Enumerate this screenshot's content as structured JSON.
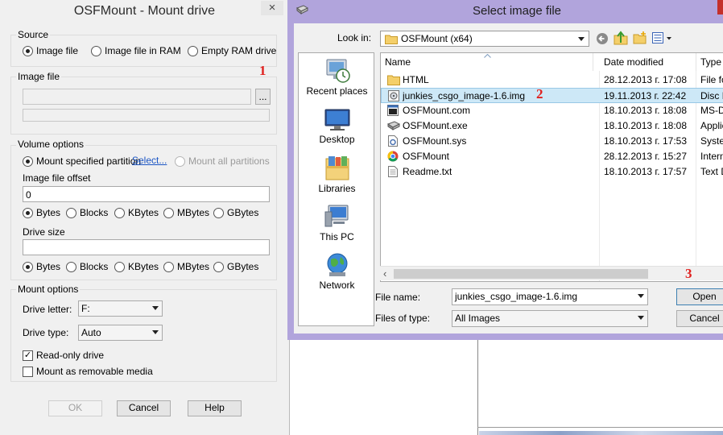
{
  "osfmount": {
    "title": "OSFMount - Mount drive",
    "close_glyph": "×",
    "source": {
      "group_label": "Source",
      "options": [
        "Image file",
        "Image file in RAM",
        "Empty RAM drive"
      ],
      "selected": "Image file"
    },
    "image_file": {
      "group_label": "Image file",
      "path_value": "",
      "browse_label": "..."
    },
    "volume_options": {
      "group_label": "Volume options",
      "mount_specified_partition": "Mount specified partition",
      "select_link": "Select...",
      "mount_all_partitions": "Mount all partitions",
      "offset_label": "Image file offset",
      "offset_value": "0",
      "units": [
        "Bytes",
        "Blocks",
        "KBytes",
        "MBytes",
        "GBytes"
      ],
      "drive_size_label": "Drive size",
      "drive_size_value": ""
    },
    "mount_options": {
      "group_label": "Mount options",
      "drive_letter_label": "Drive letter:",
      "drive_letter_value": "F:",
      "drive_type_label": "Drive type:",
      "drive_type_value": "Auto",
      "read_only_label": "Read-only drive",
      "read_only_checked": true,
      "removable_label": "Mount as removable media",
      "removable_checked": false
    },
    "buttons": {
      "ok": "OK",
      "cancel": "Cancel",
      "help": "Help"
    }
  },
  "select_dialog": {
    "title": "Select image file",
    "look_in_label": "Look in:",
    "look_in_value": "OSFMount (x64)",
    "places": [
      "Recent places",
      "Desktop",
      "Libraries",
      "This PC",
      "Network"
    ],
    "columns": [
      "Name",
      "Date modified",
      "Type"
    ],
    "files": [
      {
        "name": "HTML",
        "date": "28.12.2013 г. 17:08",
        "type": "File fol",
        "icon": "folder-icon"
      },
      {
        "name": "junkies_csgo_image-1.6.img",
        "date": "19.11.2013 г. 22:42",
        "type": "Disc Im",
        "icon": "disc-image-icon",
        "selected": true
      },
      {
        "name": "OSFMount.com",
        "date": "18.10.2013 г. 18:08",
        "type": "MS-DO",
        "icon": "console-app-icon"
      },
      {
        "name": "OSFMount.exe",
        "date": "18.10.2013 г. 18:08",
        "type": "Applica",
        "icon": "drive-app-icon"
      },
      {
        "name": "OSFMount.sys",
        "date": "18.10.2013 г. 17:53",
        "type": "System",
        "icon": "system-file-icon"
      },
      {
        "name": "OSFMount",
        "date": "28.12.2013 г. 15:27",
        "type": "Interne",
        "icon": "chrome-icon"
      },
      {
        "name": "Readme.txt",
        "date": "18.10.2013 г. 17:57",
        "type": "Text Do",
        "icon": "text-file-icon"
      }
    ],
    "file_name_label": "File name:",
    "file_name_value": "junkies_csgo_image-1.6.img",
    "files_of_type_label": "Files of type:",
    "files_of_type_value": "All Images",
    "open_label": "Open",
    "cancel_label": "Cancel"
  },
  "annotations": [
    "1",
    "2",
    "3"
  ],
  "colors": {
    "annotation_red": "#e0201e",
    "dialog_titlebar": "#b1a4dc",
    "selection_blue": "#cde8f7",
    "window_bg": "#f0f0f0"
  }
}
